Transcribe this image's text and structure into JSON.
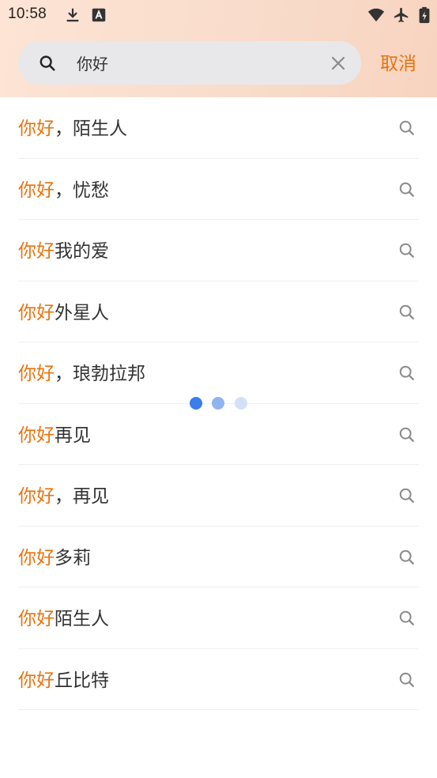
{
  "status_bar": {
    "time": "10:58",
    "icons": [
      "download-icon",
      "a-box-icon",
      "wifi-icon",
      "airplane-icon",
      "battery-charging-icon"
    ]
  },
  "search": {
    "query": "你好",
    "cancel_label": "取消"
  },
  "results": [
    {
      "highlight": "你好",
      "rest": "，陌生人"
    },
    {
      "highlight": "你好",
      "rest": "，忧愁"
    },
    {
      "highlight": "你好",
      "rest": "我的爱"
    },
    {
      "highlight": "你好",
      "rest": "外星人"
    },
    {
      "highlight": "你好",
      "rest": "，琅勃拉邦"
    },
    {
      "highlight": "你好",
      "rest": "再见"
    },
    {
      "highlight": "你好",
      "rest": "，再见"
    },
    {
      "highlight": "你好",
      "rest": "多莉"
    },
    {
      "highlight": "你好",
      "rest": "陌生人"
    },
    {
      "highlight": "你好",
      "rest": "丘比特"
    }
  ],
  "colors": {
    "accent": "#e8730f",
    "text": "#333333",
    "icon_gray": "#8a8a8a",
    "dot_1": "#3b7de9",
    "dot_2": "#8fb4f0",
    "dot_3": "#d3e1f8"
  }
}
